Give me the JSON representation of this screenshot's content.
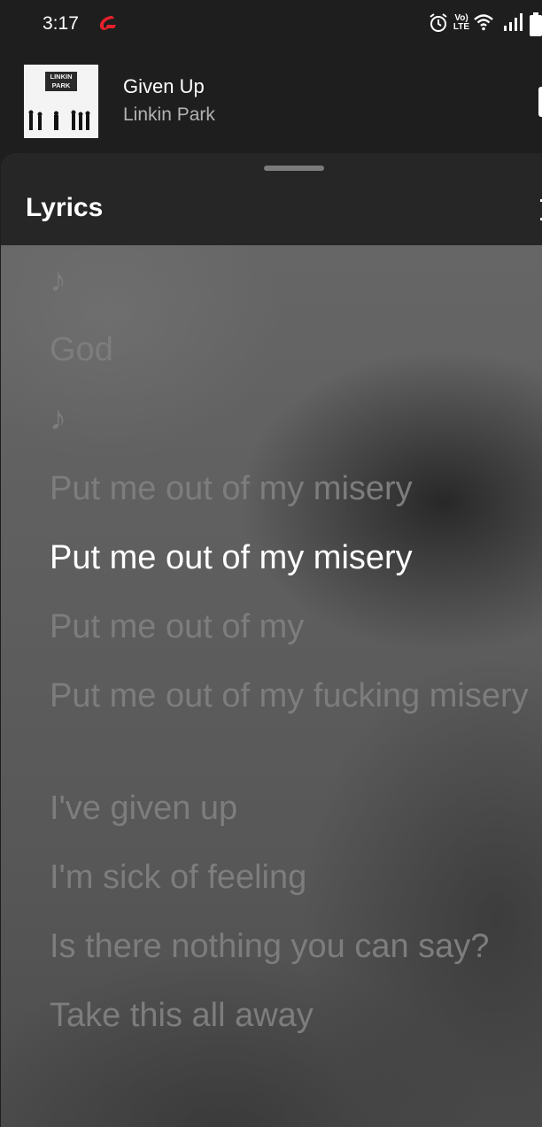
{
  "status_bar": {
    "time": "3:17",
    "volte_label": "Vo) LTE",
    "icons": [
      "carrier-icon",
      "alarm-icon",
      "volte-icon",
      "wifi-icon",
      "signal-icon",
      "battery-icon"
    ]
  },
  "now_playing": {
    "album_logo_text": "LINKIN PARK",
    "title": "Given Up",
    "artist": "Linkin Park"
  },
  "lyrics_sheet": {
    "title": "Lyrics",
    "lines": [
      "♪",
      "God",
      "♪",
      "Put me out of my misery",
      "Put me out of my misery",
      "Put me out of my",
      "Put me out of my fucking misery",
      "I've given up",
      "I'm sick of feeling",
      "Is there nothing you can say?",
      "Take this all away"
    ],
    "active_line_index": 4
  },
  "colors": {
    "background": "#1e1e1e",
    "sheet_header": "#262626",
    "lyric_inactive": "#7d7d7d",
    "lyric_active": "#ffffff",
    "artist_text": "#b3b3b3",
    "carrier_red": "#e8202a"
  }
}
